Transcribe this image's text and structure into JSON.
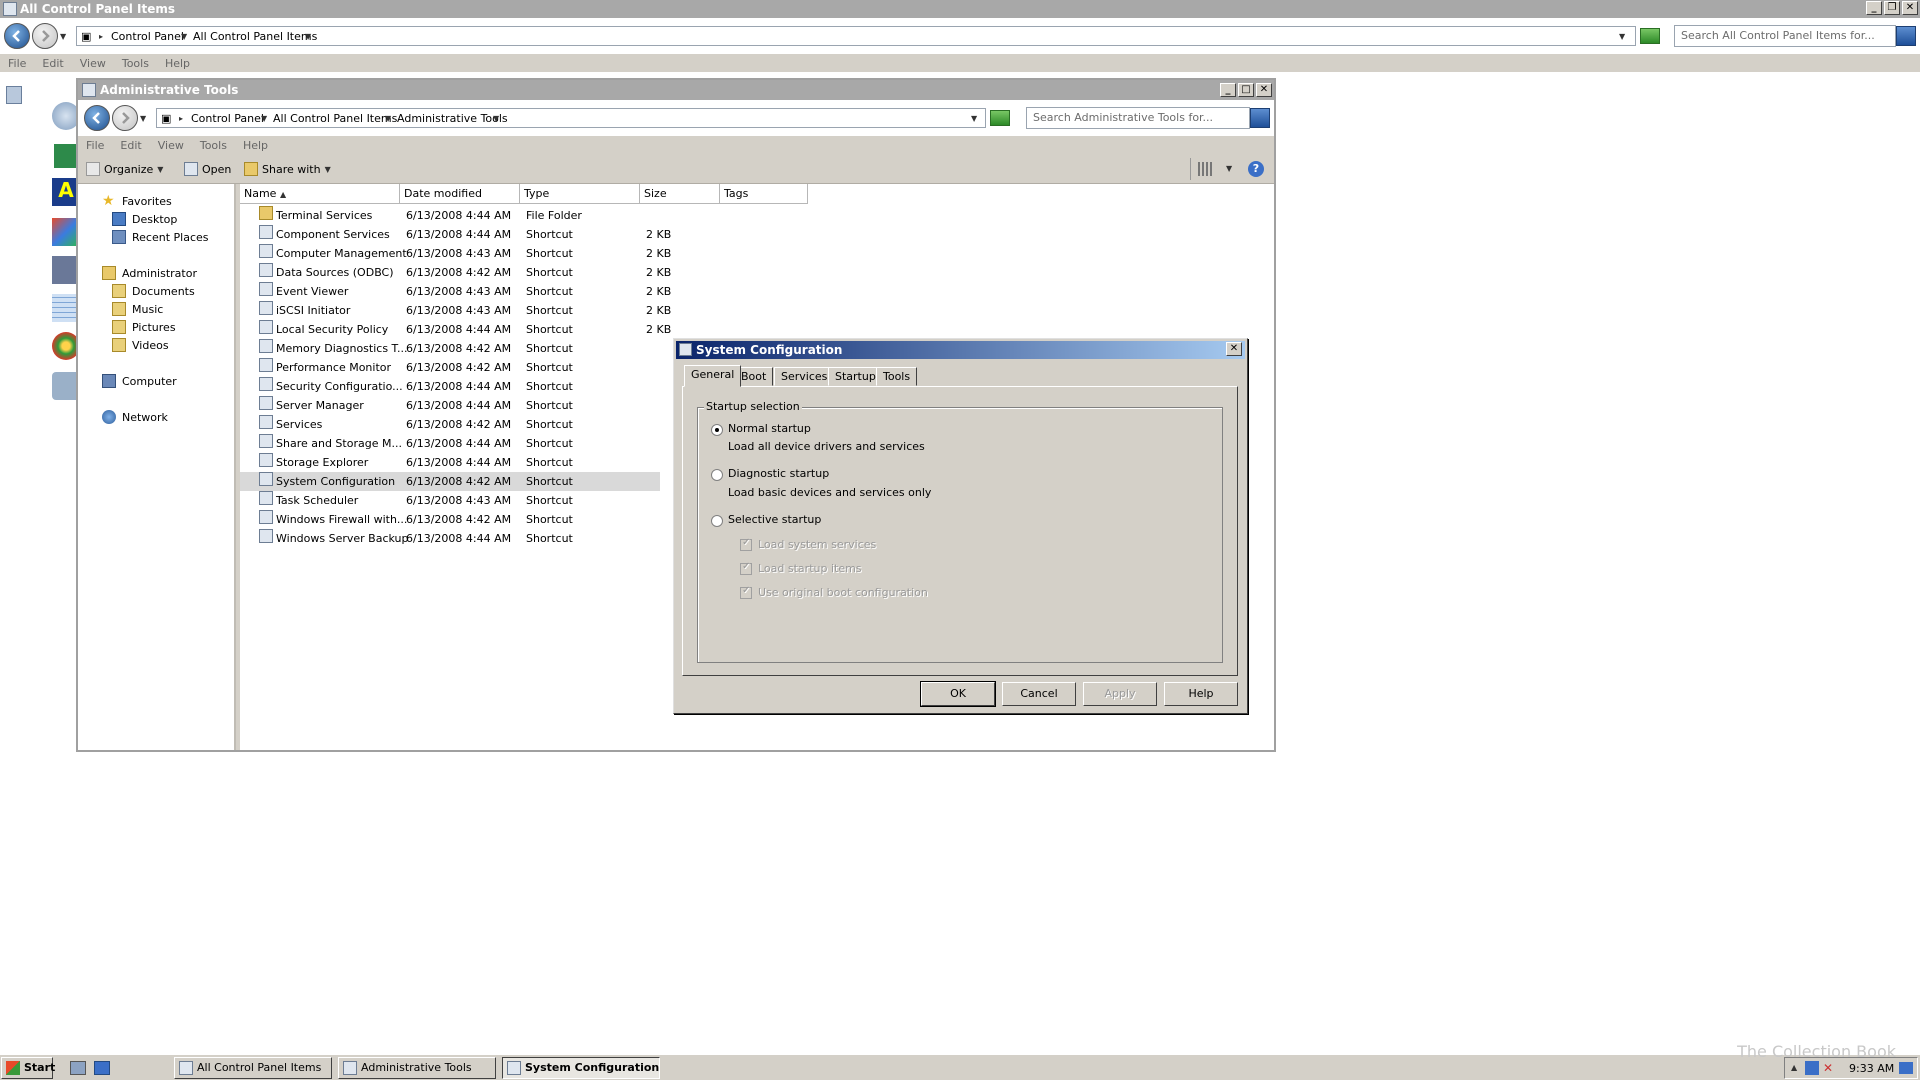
{
  "outer": {
    "title": "All Control Panel Items",
    "breadcrumb": [
      "Control Panel",
      "All Control Panel Items"
    ],
    "search_placeholder": "Search All Control Panel Items for...",
    "menu": [
      "File",
      "Edit",
      "View",
      "Tools",
      "Help"
    ]
  },
  "explorer": {
    "title": "Administrative Tools",
    "breadcrumb": [
      "Control Panel",
      "All Control Panel Items",
      "Administrative Tools"
    ],
    "search_placeholder": "Search Administrative Tools for...",
    "menu": [
      "File",
      "Edit",
      "View",
      "Tools",
      "Help"
    ],
    "commands": {
      "organize": "Organize",
      "open": "Open",
      "share": "Share with"
    },
    "nav": {
      "favorites": "Favorites",
      "favorites_items": [
        "Desktop",
        "Recent Places"
      ],
      "user": "Administrator",
      "user_items": [
        "Documents",
        "Music",
        "Pictures",
        "Videos"
      ],
      "computer": "Computer",
      "network": "Network"
    },
    "columns": {
      "name": "Name",
      "date": "Date modified",
      "type": "Type",
      "size": "Size",
      "tags": "Tags"
    },
    "files": [
      {
        "name": "Terminal Services",
        "date": "6/13/2008 4:44 AM",
        "type": "File Folder",
        "size": ""
      },
      {
        "name": "Component Services",
        "date": "6/13/2008 4:44 AM",
        "type": "Shortcut",
        "size": "2 KB"
      },
      {
        "name": "Computer Management",
        "date": "6/13/2008 4:43 AM",
        "type": "Shortcut",
        "size": "2 KB"
      },
      {
        "name": "Data Sources (ODBC)",
        "date": "6/13/2008 4:42 AM",
        "type": "Shortcut",
        "size": "2 KB"
      },
      {
        "name": "Event Viewer",
        "date": "6/13/2008 4:43 AM",
        "type": "Shortcut",
        "size": "2 KB"
      },
      {
        "name": "iSCSI Initiator",
        "date": "6/13/2008 4:43 AM",
        "type": "Shortcut",
        "size": "2 KB"
      },
      {
        "name": "Local Security Policy",
        "date": "6/13/2008 4:44 AM",
        "type": "Shortcut",
        "size": "2 KB"
      },
      {
        "name": "Memory Diagnostics T...",
        "date": "6/13/2008 4:42 AM",
        "type": "Shortcut",
        "size": ""
      },
      {
        "name": "Performance Monitor",
        "date": "6/13/2008 4:42 AM",
        "type": "Shortcut",
        "size": ""
      },
      {
        "name": "Security Configuratio...",
        "date": "6/13/2008 4:44 AM",
        "type": "Shortcut",
        "size": ""
      },
      {
        "name": "Server Manager",
        "date": "6/13/2008 4:44 AM",
        "type": "Shortcut",
        "size": ""
      },
      {
        "name": "Services",
        "date": "6/13/2008 4:42 AM",
        "type": "Shortcut",
        "size": ""
      },
      {
        "name": "Share and Storage M...",
        "date": "6/13/2008 4:44 AM",
        "type": "Shortcut",
        "size": ""
      },
      {
        "name": "Storage Explorer",
        "date": "6/13/2008 4:44 AM",
        "type": "Shortcut",
        "size": ""
      },
      {
        "name": "System Configuration",
        "date": "6/13/2008 4:42 AM",
        "type": "Shortcut",
        "size": ""
      },
      {
        "name": "Task Scheduler",
        "date": "6/13/2008 4:43 AM",
        "type": "Shortcut",
        "size": ""
      },
      {
        "name": "Windows Firewall with...",
        "date": "6/13/2008 4:42 AM",
        "type": "Shortcut",
        "size": ""
      },
      {
        "name": "Windows Server Backup",
        "date": "6/13/2008 4:44 AM",
        "type": "Shortcut",
        "size": ""
      }
    ]
  },
  "dialog": {
    "title": "System Configuration",
    "tabs": [
      "General",
      "Boot",
      "Services",
      "Startup",
      "Tools"
    ],
    "group_label": "Startup selection",
    "normal_label": "Normal startup",
    "normal_desc": "Load all device drivers and services",
    "diagnostic_label": "Diagnostic startup",
    "diagnostic_desc": "Load basic devices and services only",
    "selective_label": "Selective startup",
    "check_system": "Load system services",
    "check_startup": "Load startup items",
    "check_boot": "Use original boot configuration",
    "selected": "normal",
    "buttons": {
      "ok": "OK",
      "cancel": "Cancel",
      "apply": "Apply",
      "help": "Help"
    }
  },
  "taskbar": {
    "start": "Start",
    "items": [
      "All Control Panel Items",
      "Administrative Tools",
      "System Configuration"
    ],
    "clock": "9:33 AM"
  },
  "watermark": "The Collection Book"
}
